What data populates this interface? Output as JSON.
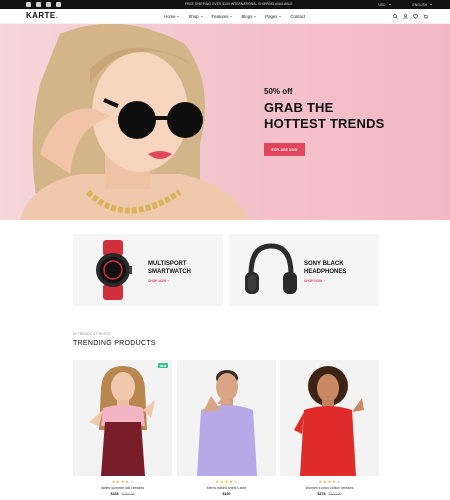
{
  "topbar": {
    "social_icons": [
      "facebook-icon",
      "youtube-icon",
      "twitter-icon",
      "instagram-icon"
    ],
    "promo_text": "FREE SHIPPING OVER $100 INTERNATIONAL SHIPPING AVAILABLE",
    "currency": "USD",
    "language": "ENGLISH"
  },
  "header": {
    "logo": "KARTE",
    "logo_dot": ".",
    "nav": [
      "Home",
      "Shop",
      "Features",
      "Blogs",
      "Pages",
      "Contact"
    ],
    "icons": [
      "search-icon",
      "user-icon",
      "heart-icon",
      "cart-icon"
    ]
  },
  "hero": {
    "offer": "50% off",
    "title_line1": "GRAB THE",
    "title_line2": "HOTTEST TRENDS",
    "button": "EXPLORE NOW"
  },
  "promos": [
    {
      "title_line1": "MULTISPORT",
      "title_line2": "SMARTWATCH",
      "link": "SHOP NOW"
    },
    {
      "title_line1": "SONY BLACK",
      "title_line2": "HEADPHONES",
      "link": "SHOP NOW"
    }
  ],
  "trending": {
    "eyebrow": "IN TRENDS & FROSTS",
    "title": "TRENDING PRODUCTS",
    "products": [
      {
        "name": "ladies summer silk dresses",
        "price": "$168",
        "old_price": "$245.99",
        "badge": "NEW",
        "rating": 4
      },
      {
        "name": "Men's naked shirts t-shirt",
        "price": "$190",
        "old_price": "",
        "badge": "",
        "rating": 4
      },
      {
        "name": "Women's lotus cotton dresses",
        "price": "$278",
        "old_price": "$315.00",
        "badge": "",
        "rating": 4
      }
    ]
  },
  "colors": {
    "accent": "#e2465a",
    "hero_bg": "#f4c2cb",
    "badge": "#3bbf8f",
    "star": "#f5a623"
  }
}
